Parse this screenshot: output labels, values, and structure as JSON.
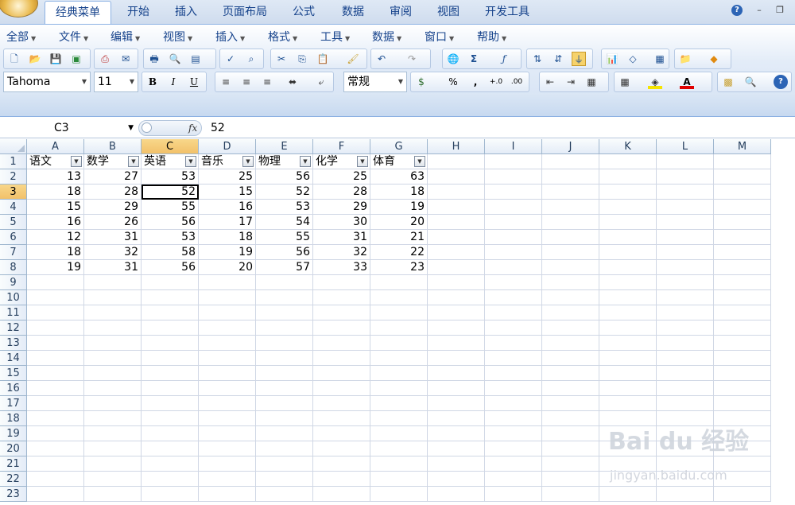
{
  "tabs": [
    "经典菜单",
    "开始",
    "插入",
    "页面布局",
    "公式",
    "数据",
    "审阅",
    "视图",
    "开发工具"
  ],
  "menu": [
    "全部",
    "文件",
    "编辑",
    "视图",
    "插入",
    "格式",
    "工具",
    "数据",
    "窗口",
    "帮助"
  ],
  "font": {
    "name": "Tahoma",
    "size": "11",
    "number_format": "常规"
  },
  "namebox": "C3",
  "fx_label": "fx",
  "formula_value": "52",
  "columns": [
    "A",
    "B",
    "C",
    "D",
    "E",
    "F",
    "G",
    "H",
    "I",
    "J",
    "K",
    "L",
    "M"
  ],
  "selected_col": "C",
  "selected_row": 3,
  "headers": [
    "语文",
    "数学",
    "英语",
    "音乐",
    "物理",
    "化学",
    "体育"
  ],
  "rows": [
    [
      13,
      27,
      53,
      25,
      56,
      25,
      63
    ],
    [
      18,
      28,
      52,
      15,
      52,
      28,
      18
    ],
    [
      15,
      29,
      55,
      16,
      53,
      29,
      19
    ],
    [
      16,
      26,
      56,
      17,
      54,
      30,
      20
    ],
    [
      12,
      31,
      53,
      18,
      55,
      31,
      21
    ],
    [
      18,
      32,
      58,
      19,
      56,
      32,
      22
    ],
    [
      19,
      31,
      56,
      20,
      57,
      33,
      23
    ]
  ],
  "row_numbers": [
    "1",
    "2",
    "3",
    "4",
    "5",
    "6",
    "7",
    "8",
    "9",
    "10",
    "11",
    "12",
    "13",
    "14",
    "15",
    "16",
    "17",
    "18",
    "19",
    "20",
    "21",
    "22",
    "23"
  ],
  "watermark": {
    "logo": "Bai du 经验",
    "url": "jingyan.baidu.com"
  }
}
